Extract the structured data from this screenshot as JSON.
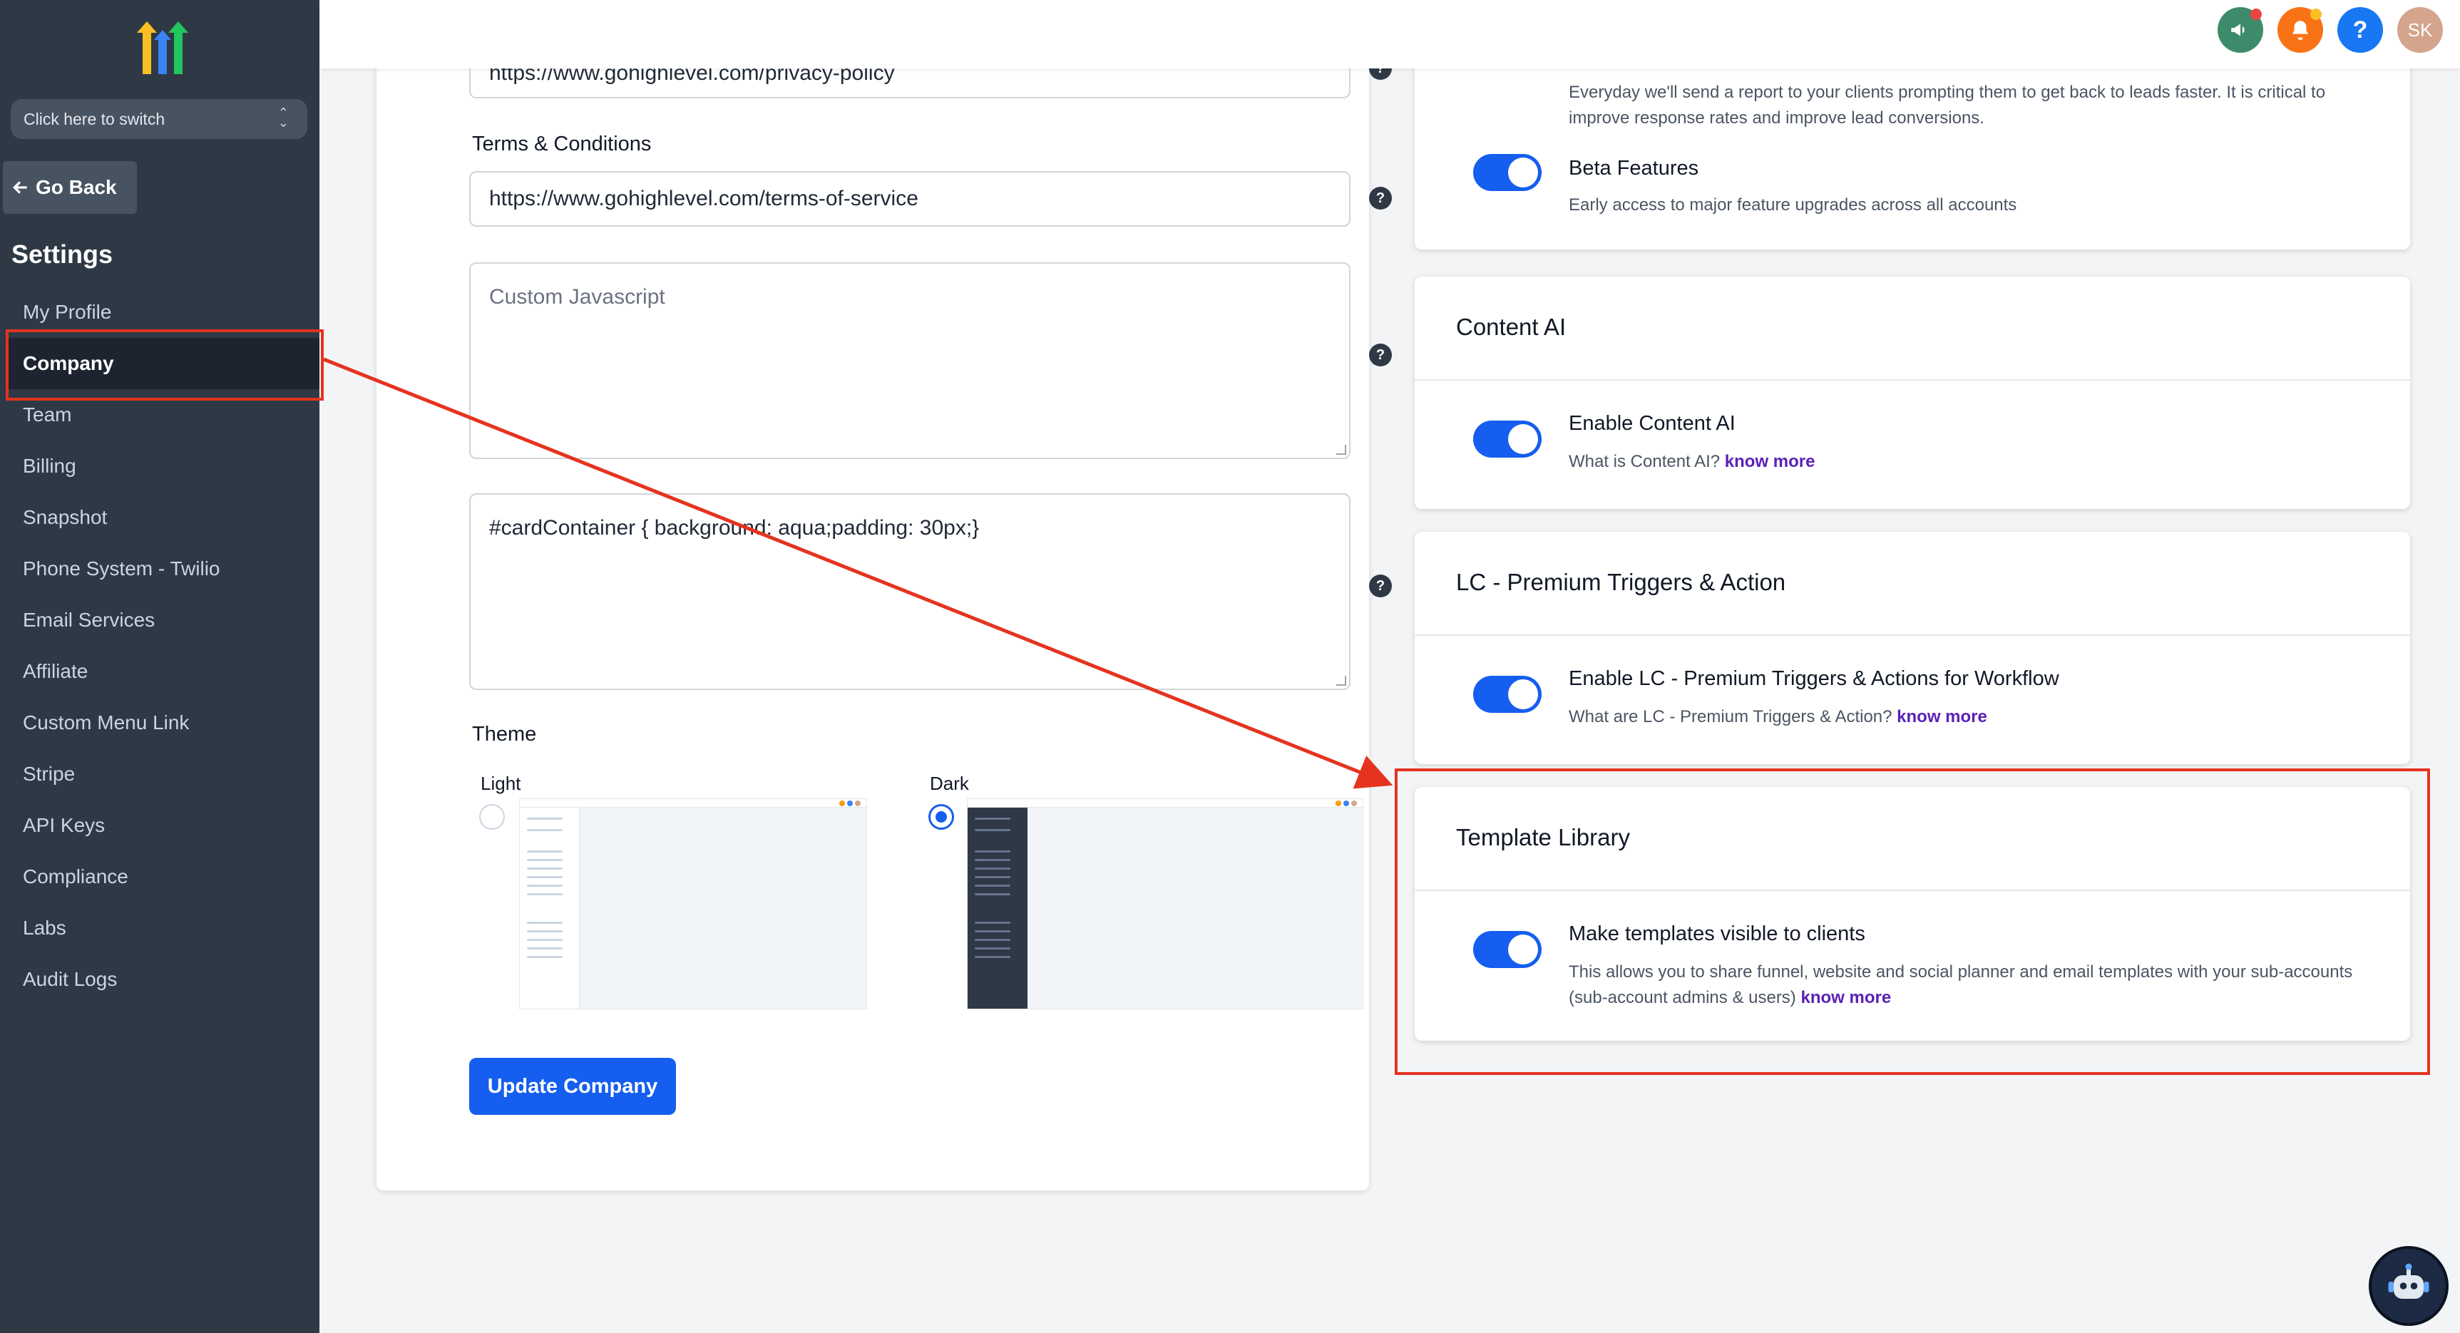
{
  "sidebar": {
    "switcher_label": "Click here to switch",
    "go_back_label": "Go Back",
    "settings_title": "Settings",
    "items": [
      {
        "label": "My Profile"
      },
      {
        "label": "Company"
      },
      {
        "label": "Team"
      },
      {
        "label": "Billing"
      },
      {
        "label": "Snapshot"
      },
      {
        "label": "Phone System - Twilio"
      },
      {
        "label": "Email Services"
      },
      {
        "label": "Affiliate"
      },
      {
        "label": "Custom Menu Link"
      },
      {
        "label": "Stripe"
      },
      {
        "label": "API Keys"
      },
      {
        "label": "Compliance"
      },
      {
        "label": "Labs"
      },
      {
        "label": "Audit Logs"
      }
    ],
    "active_item": "Company"
  },
  "topbar": {
    "avatar_initials": "SK",
    "help_glyph": "?",
    "icons": [
      "megaphone-icon",
      "bell-icon",
      "help-icon",
      "avatar"
    ],
    "colors": {
      "megaphone": "#3d8b6a",
      "bell": "#f97316",
      "help": "#1877f2",
      "avatar": "#d4a48c"
    }
  },
  "form": {
    "privacy_value": "https://www.gohighlevel.com/privacy-policy",
    "terms_label": "Terms & Conditions",
    "terms_value": "https://www.gohighlevel.com/terms-of-service",
    "custom_js_placeholder": "Custom Javascript",
    "custom_css_value": "#cardContainer {    background: aqua;padding: 30px;}",
    "help_glyph": "?",
    "theme_label": "Theme",
    "theme_options": [
      {
        "label": "Light",
        "selected": false
      },
      {
        "label": "Dark",
        "selected": true
      }
    ],
    "update_button": "Update Company"
  },
  "cards": {
    "reports": {
      "desc": "Everyday we'll send a report to your clients prompting them to get back to leads faster. It is critical to improve response rates and improve lead conversions.",
      "enabled": true
    },
    "beta": {
      "title": "Beta Features",
      "desc": "Early access to major feature upgrades across all accounts",
      "enabled": true
    },
    "content_ai": {
      "title": "Content AI",
      "option_title": "Enable Content AI",
      "desc": "What is Content AI?",
      "link": "know more",
      "enabled": true
    },
    "lc_premium": {
      "title": "LC - Premium Triggers & Action",
      "option_title": "Enable LC - Premium Triggers & Actions for Workflow",
      "desc": "What are LC - Premium Triggers & Action?",
      "link": "know more",
      "enabled": true
    },
    "template_library": {
      "title": "Template Library",
      "option_title": "Make templates visible to clients",
      "desc": "This allows you to share funnel, website and social planner and email templates with your sub-accounts (sub-account admins & users)",
      "link": "know more",
      "enabled": true
    }
  },
  "colors": {
    "sidebar_bg": "#2f3946",
    "primary": "#155eef",
    "annotation_red": "#e5331f",
    "link_purple": "#5b21b6"
  }
}
